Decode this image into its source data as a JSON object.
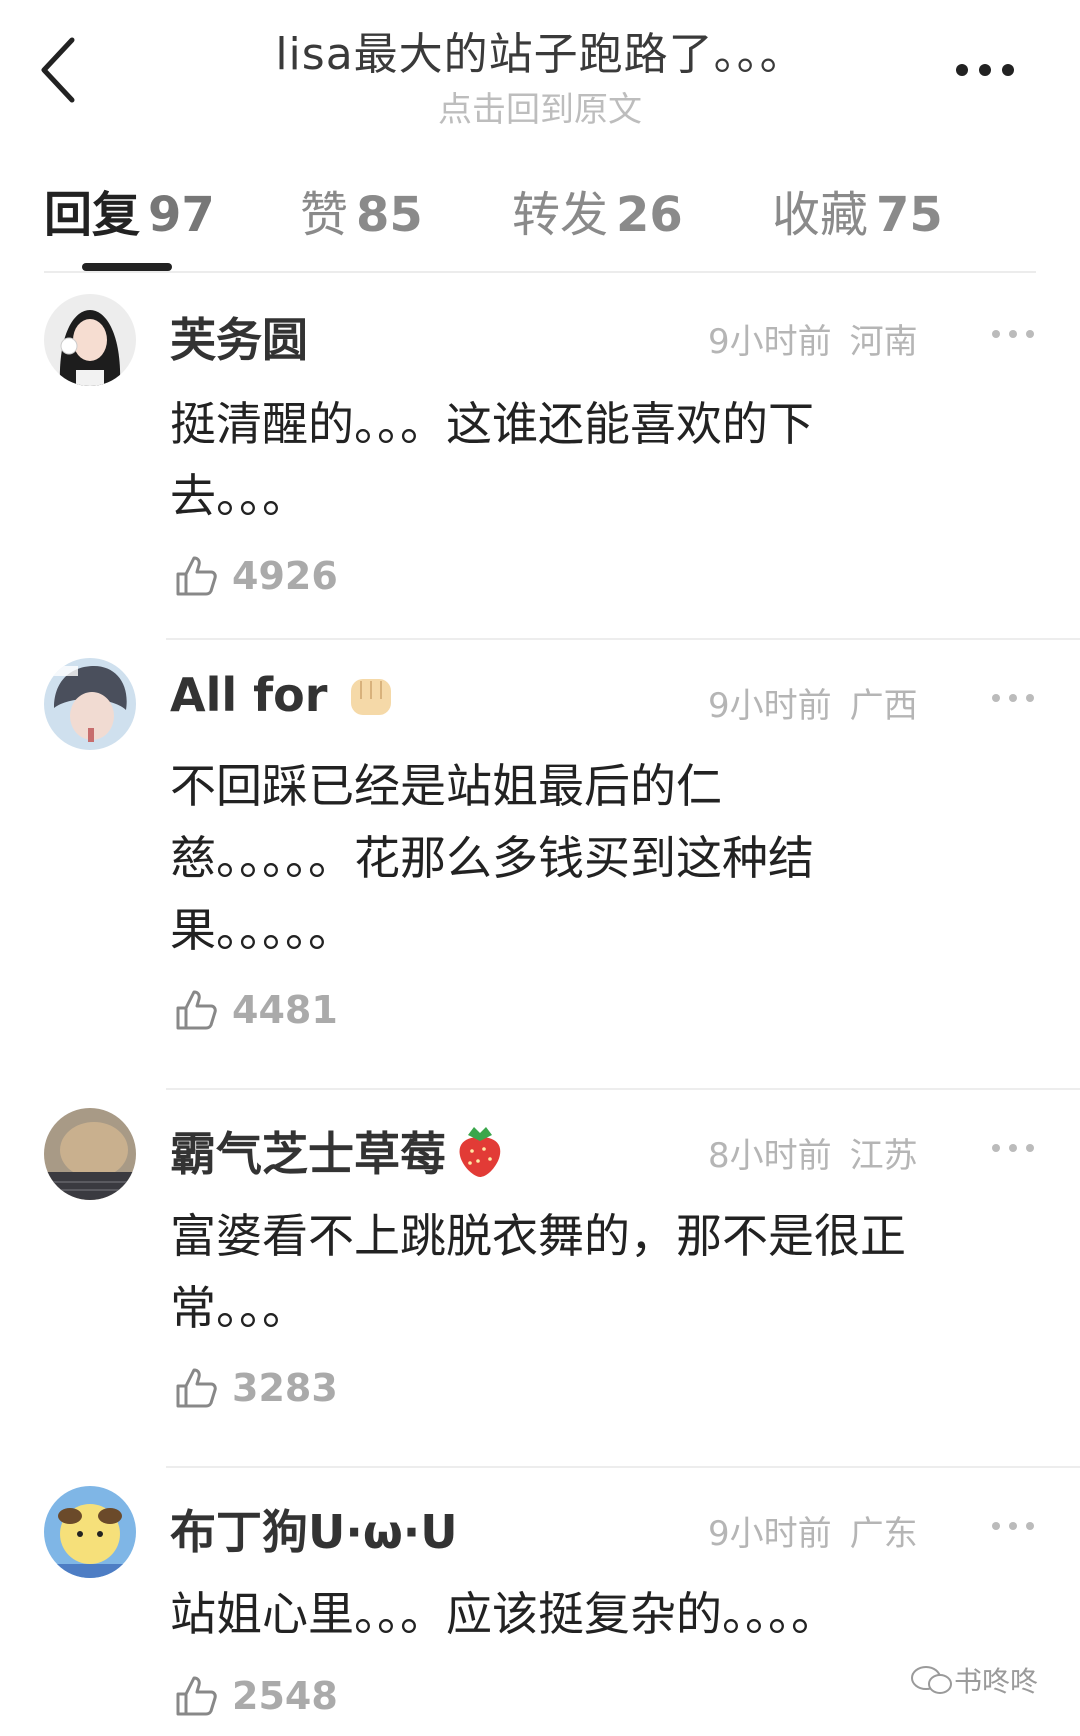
{
  "header": {
    "title": "lisa最大的站子跑路了。。。",
    "subtitle": "点击回到原文"
  },
  "tabs": [
    {
      "label": "回复",
      "count": "97"
    },
    {
      "label": "赞",
      "count": "85"
    },
    {
      "label": "转发",
      "count": "26"
    },
    {
      "label": "收藏",
      "count": "75"
    }
  ],
  "comments": [
    {
      "username": "芙务圆",
      "time": "9小时前",
      "location": "河南",
      "line1": "挺清醒的。。。这谁还能喜欢的下",
      "line2": "去。。。",
      "likes": "4926"
    },
    {
      "username": "All for",
      "emoji": "fist-bump-icon",
      "time": "9小时前",
      "location": "广西",
      "line1": "不回踩已经是站姐最后的仁",
      "line2": "慈。。。。。花那么多钱买到这种结",
      "line3": "果。。。。。",
      "likes": "4481"
    },
    {
      "username": "霸气芝士草莓",
      "emoji": "strawberry-icon",
      "time": "8小时前",
      "location": "江苏",
      "line1": "富婆看不上跳脱衣舞的，那不是很正",
      "line2": "常。。。",
      "likes": "3283"
    },
    {
      "username": "布丁狗U·ω·U",
      "time": "9小时前",
      "location": "广东",
      "line1": "站姐心里。。。应该挺复杂的。。。。",
      "likes": "2548"
    }
  ],
  "watermark": "书咚咚"
}
